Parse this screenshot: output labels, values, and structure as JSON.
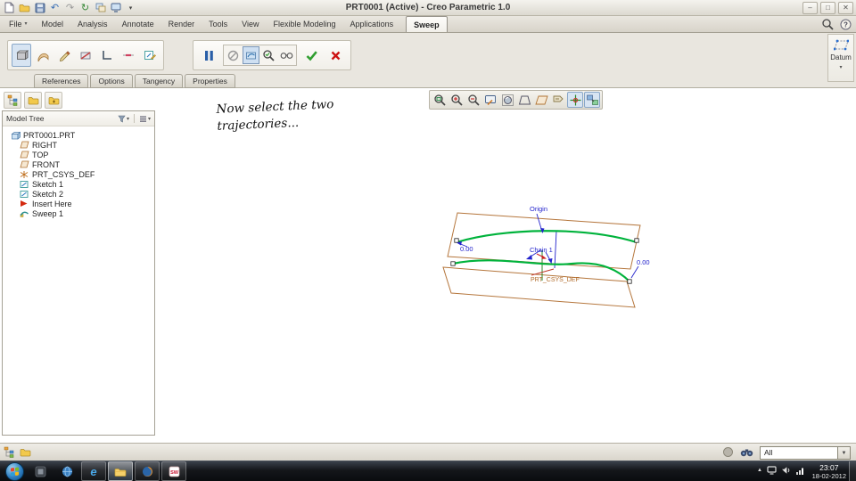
{
  "window": {
    "title": "PRT0001 (Active) - Creo Parametric 1.0"
  },
  "colors": {
    "trajectory": "#00b33c",
    "datum": "#b5763c",
    "dimension": "#2323cc",
    "csys_label": "#b06a28",
    "ok": "#2f9e2f",
    "cancel": "#cc1111"
  },
  "quick_access": {
    "icons": [
      "new",
      "open",
      "save",
      "undo",
      "redo",
      "regenerate",
      "windows",
      "display",
      "customize-dropdown"
    ]
  },
  "tab_row_right": {
    "icons": [
      "search",
      "help"
    ]
  },
  "ribbon": {
    "tabs": [
      {
        "label": "File",
        "dropdown": true
      },
      {
        "label": "Model"
      },
      {
        "label": "Analysis"
      },
      {
        "label": "Annotate"
      },
      {
        "label": "Render"
      },
      {
        "label": "Tools"
      },
      {
        "label": "View"
      },
      {
        "label": "Flexible Modeling"
      },
      {
        "label": "Applications"
      },
      {
        "label": "Sweep",
        "active": true
      }
    ],
    "sweep_tools": [
      {
        "icon": "solid",
        "selected": true
      },
      {
        "icon": "surface"
      },
      {
        "icon": "sketch"
      },
      {
        "icon": "remove-material"
      },
      {
        "icon": "thin"
      },
      {
        "icon": "section-line"
      },
      {
        "icon": "edit-sketch"
      }
    ],
    "dashboard_toggles": [
      {
        "icon": "no-preview"
      },
      {
        "icon": "attached-preview",
        "selected": true
      },
      {
        "icon": "verify"
      },
      {
        "icon": "glasses"
      }
    ],
    "dashboard_tabs": [
      "References",
      "Options",
      "Tangency",
      "Properties"
    ],
    "datum_label": "Datum"
  },
  "graphics_toolbar": [
    "refit",
    "zoom-in",
    "zoom-out",
    "repaint",
    "display-style",
    "perspective",
    "datum-display",
    "annotation-display",
    "spin-center",
    "view-manager"
  ],
  "navigator": {
    "toolbar": [
      "tree-nav",
      "folder-nav",
      "folder-add"
    ],
    "title": "Model Tree",
    "items": [
      {
        "label": "PRT0001.PRT",
        "icon": "part",
        "level": 0
      },
      {
        "label": "RIGHT",
        "icon": "plane",
        "level": 1
      },
      {
        "label": "TOP",
        "icon": "plane",
        "level": 1
      },
      {
        "label": "FRONT",
        "icon": "plane",
        "level": 1
      },
      {
        "label": "PRT_CSYS_DEF",
        "icon": "csys",
        "level": 1
      },
      {
        "label": "Sketch 1",
        "icon": "sketch-item",
        "level": 1
      },
      {
        "label": "Sketch 2",
        "icon": "sketch-item",
        "level": 1
      },
      {
        "label": "Insert Here",
        "icon": "insert",
        "level": 1
      },
      {
        "label": "Sweep 1",
        "icon": "sweep-item",
        "level": 1
      }
    ]
  },
  "canvas": {
    "note_line1": "Now select the two",
    "note_line2": "trajectories...",
    "labels": {
      "origin": "Origin",
      "chain": "Chain 1",
      "dim_left": "0.00",
      "dim_right": "0.00",
      "csys": "PRT_CSYS_DEF"
    }
  },
  "status_bar": {
    "filter": "All"
  },
  "taskbar": {
    "apps": [
      {
        "name": "media-app"
      },
      {
        "name": "globe-app"
      },
      {
        "name": "internet-explorer",
        "framed": true
      },
      {
        "name": "windows-explorer",
        "framed": true,
        "active": true
      },
      {
        "name": "firefox",
        "framed": true
      },
      {
        "name": "solidworks",
        "framed": true,
        "label": "SW"
      }
    ],
    "clock": {
      "time": "23:07",
      "date": "18-02-2012"
    }
  }
}
